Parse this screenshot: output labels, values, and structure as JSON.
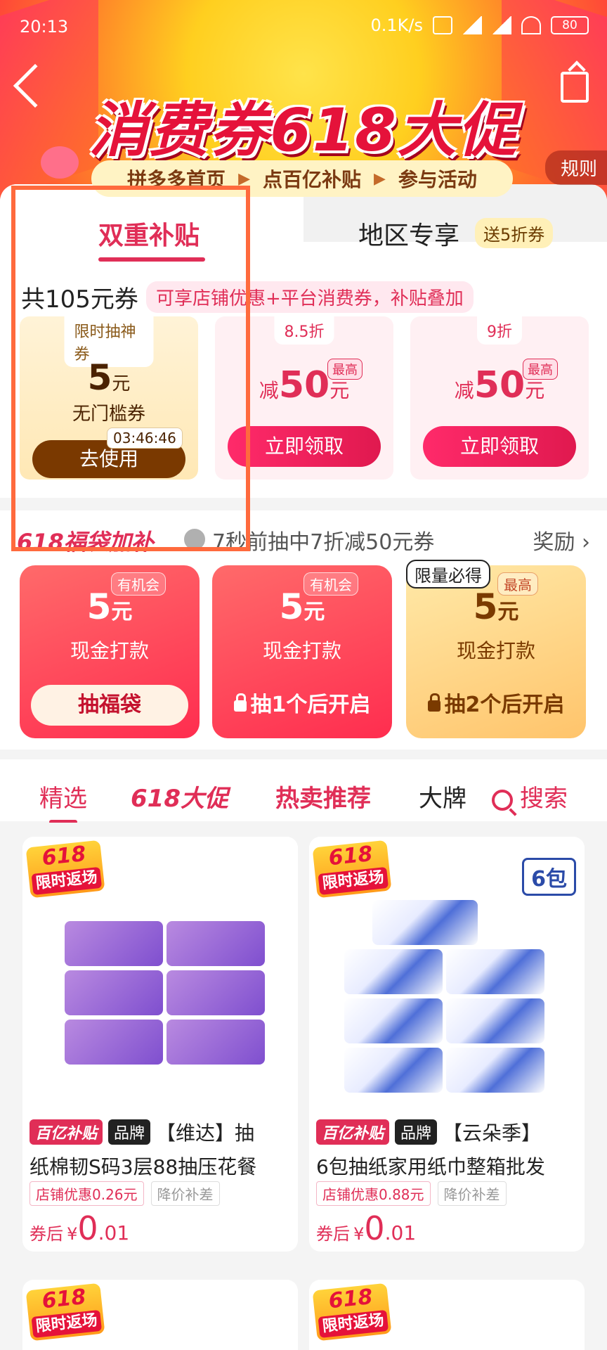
{
  "status": {
    "time": "20:13",
    "speed": "0.1K/s",
    "battery": "80"
  },
  "hero": {
    "title": "消费券618大促",
    "rules": "规则",
    "steps": [
      "拼多多首页",
      "点百亿补贴",
      "参与活动"
    ]
  },
  "tabs": {
    "active": "双重补贴",
    "other": "地区专享",
    "other_badge": "送5折券"
  },
  "summary": {
    "total": "共105元券",
    "tip": "可享店铺优惠+平台消费券，补贴叠加"
  },
  "coupons": [
    {
      "tag": "限时抽神券",
      "value": "5",
      "unit": "元",
      "desc": "无门槛券",
      "timer": "03:46:46",
      "button": "去使用"
    },
    {
      "tag": "8.5折",
      "prefix": "减",
      "value": "50",
      "unit": "元",
      "max": "最高",
      "button": "立即领取"
    },
    {
      "tag": "9折",
      "prefix": "减",
      "value": "50",
      "unit": "元",
      "max": "最高",
      "button": "立即领取"
    }
  ],
  "blessing": {
    "title": "618福袋加补",
    "news": "7秒前抽中7折减50元券",
    "reward": "奖励",
    "cards": [
      {
        "chip": "有机会",
        "value": "5",
        "unit": "元",
        "desc": "现金打款",
        "button": "抽福袋"
      },
      {
        "chip": "有机会",
        "value": "5",
        "unit": "元",
        "desc": "现金打款",
        "button": "抽1个后开启"
      },
      {
        "limited": "限量必得",
        "chip": "最高",
        "value": "5",
        "unit": "元",
        "desc": "现金打款",
        "button": "抽2个后开启"
      }
    ]
  },
  "filters": [
    "精选",
    "618大促",
    "热卖推荐",
    "大牌",
    "搜索"
  ],
  "products": [
    {
      "badge_top": "618",
      "badge_sub": "限时返场",
      "tag1": "百亿补贴",
      "tag2": "品牌",
      "title1": "【维达】抽",
      "title2": "纸棉韧S码3层88抽压花餐",
      "sub1": "店铺优惠0.26元",
      "sub2": "降价补差",
      "price_label": "券后",
      "currency": "¥",
      "price_int": "0",
      "price_dec": ".01"
    },
    {
      "badge_top": "618",
      "badge_sub": "限时返场",
      "count": "6包",
      "tag1": "百亿补贴",
      "tag2": "品牌",
      "title1": "【云朵季】",
      "title2": "6包抽纸家用纸巾整箱批发",
      "sub1": "店铺优惠0.88元",
      "sub2": "降价补差",
      "price_label": "券后",
      "currency": "¥",
      "price_int": "0",
      "price_dec": ".01"
    }
  ],
  "row2_badges": [
    {
      "top": "618",
      "sub": "限时返场"
    },
    {
      "top": "618",
      "sub": "限时返场"
    }
  ]
}
